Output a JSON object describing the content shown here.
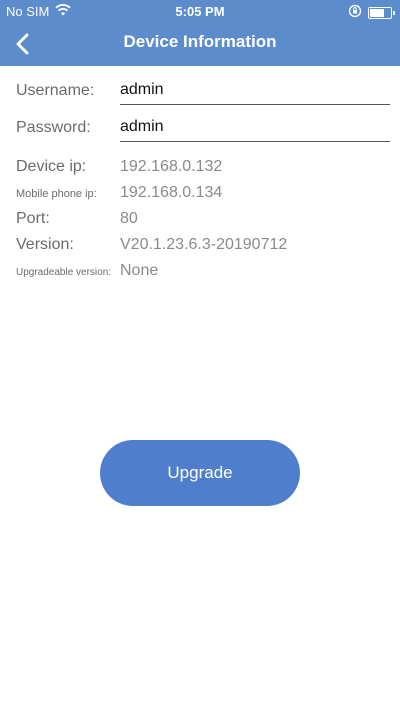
{
  "status_bar": {
    "carrier": "No SIM",
    "time": "5:05 PM",
    "battery_level": 0.8,
    "icons": [
      "wifi-icon",
      "orientation-lock-icon",
      "battery-icon"
    ]
  },
  "navbar": {
    "title": "Device Information",
    "back_icon": "chevron-left-icon"
  },
  "form": {
    "username_label": "Username:",
    "username_value": "admin",
    "password_label": "Password:",
    "password_value": "admin"
  },
  "info": {
    "device_ip_label": "Device ip:",
    "device_ip_value": "192.168.0.132",
    "mobile_ip_label": "Mobile phone ip:",
    "mobile_ip_value": "192.168.0.134",
    "port_label": "Port:",
    "port_value": "80",
    "version_label": "Version:",
    "version_value": "V20.1.23.6.3-20190712",
    "upgradeable_label": "Upgradeable version:",
    "upgradeable_value": "None"
  },
  "actions": {
    "upgrade_label": "Upgrade"
  },
  "colors": {
    "header": "#5d8ccc",
    "button": "#4f7fcc"
  }
}
